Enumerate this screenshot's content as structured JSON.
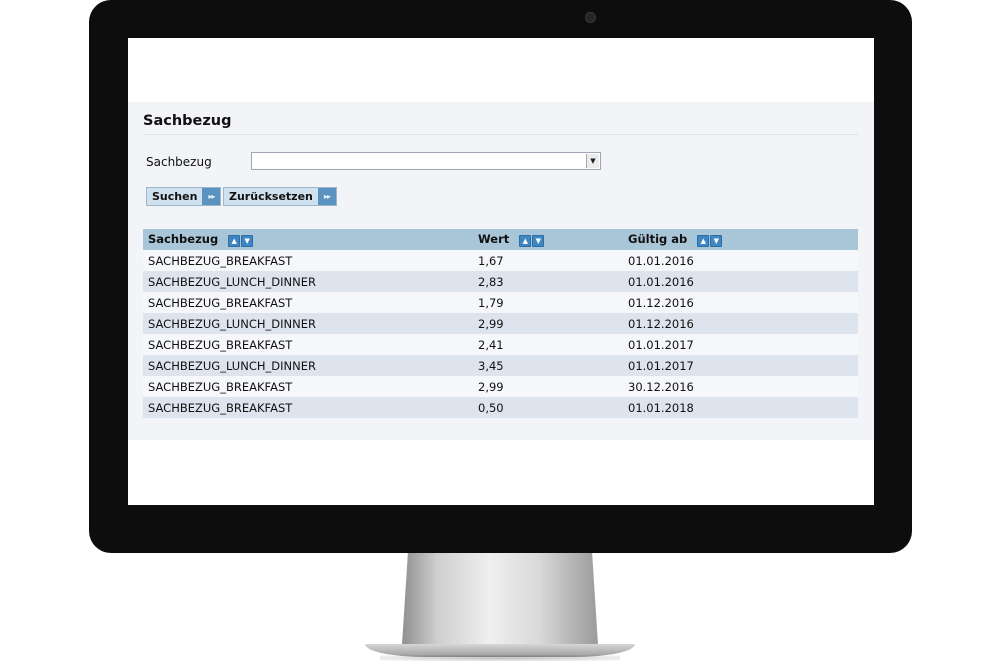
{
  "page": {
    "title": "Sachbezug"
  },
  "filter": {
    "label": "Sachbezug",
    "select_value": "",
    "dropdown_arrow": "▼"
  },
  "buttons": {
    "search_label": "Suchen",
    "reset_label": "Zurücksetzen",
    "icon_glyph": "▸▸"
  },
  "table": {
    "columns": [
      "Sachbezug",
      "Wert",
      "Gültig ab"
    ],
    "sort_up": "▲",
    "sort_down": "▼",
    "rows": [
      [
        "SACHBEZUG_BREAKFAST",
        "1,67",
        "01.01.2016"
      ],
      [
        "SACHBEZUG_LUNCH_DINNER",
        "2,83",
        "01.01.2016"
      ],
      [
        "SACHBEZUG_BREAKFAST",
        "1,79",
        "01.12.2016"
      ],
      [
        "SACHBEZUG_LUNCH_DINNER",
        "2,99",
        "01.12.2016"
      ],
      [
        "SACHBEZUG_BREAKFAST",
        "2,41",
        "01.01.2017"
      ],
      [
        "SACHBEZUG_LUNCH_DINNER",
        "3,45",
        "01.01.2017"
      ],
      [
        "SACHBEZUG_BREAKFAST",
        "2,99",
        "30.12.2016"
      ],
      [
        "SACHBEZUG_BREAKFAST",
        "0,50",
        "01.01.2018"
      ]
    ]
  },
  "colors": {
    "header_bg": "#a9c5d8",
    "row_even_bg": "#dde4ee",
    "row_odd_bg": "#f6f7fa",
    "button_bg": "#cfe0ee",
    "button_icon_bg": "#5a93bf",
    "sort_icon": "#3f86c2"
  }
}
